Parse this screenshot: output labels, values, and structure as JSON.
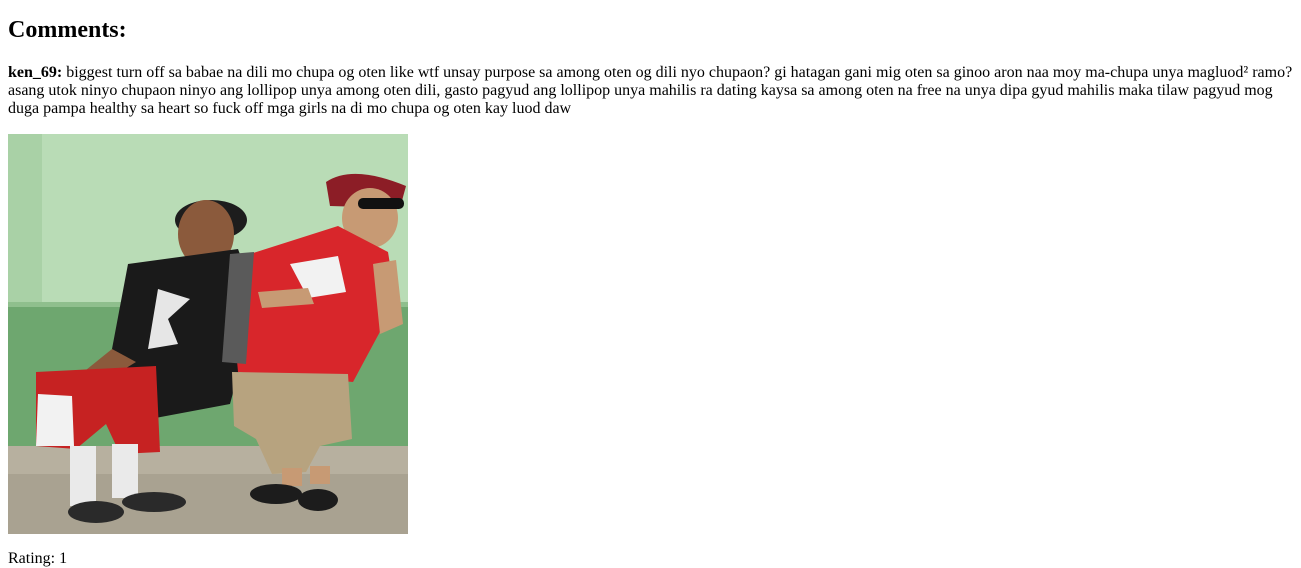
{
  "comments_section": {
    "heading": "Comments:",
    "comment": {
      "author": "ken_69:",
      "text": "biggest turn off sa babae na dili mo chupa og oten like wtf unsay purpose sa among oten og dili nyo chupaon? gi hatagan gani mig oten sa ginoo aron naa moy ma-chupa unya magluod² ramo? asang utok ninyo chupaon ninyo ang lollipop unya among oten dili, gasto pagyud ang lollipop unya mahilis ra dating kaysa sa among oten na free na unya dipa gyud mahilis maka tilaw pagyud mog duga pampa healthy sa heart so fuck off mga girls na di mo chupa og oten kay luod daw"
    },
    "photo": {
      "subject": "two-young-men-posing-photo"
    },
    "rating_label": "Rating: 1"
  }
}
